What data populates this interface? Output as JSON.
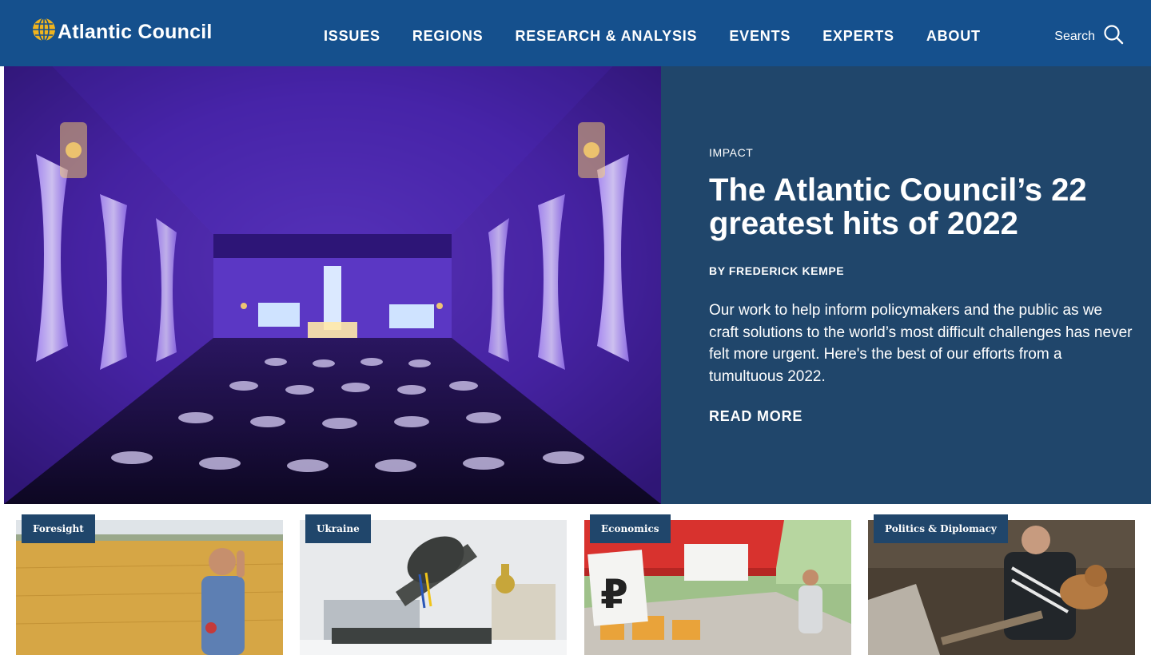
{
  "header": {
    "logo_text": "Atlantic Council",
    "nav": [
      "ISSUES",
      "REGIONS",
      "RESEARCH & ANALYSIS",
      "EVENTS",
      "EXPERTS",
      "ABOUT"
    ],
    "search_label": "Search"
  },
  "hero": {
    "kicker": "IMPACT",
    "headline": "The Atlantic Council’s 22 greatest hits of 2022",
    "byline": "BY FREDERICK KEMPE",
    "dek": "Our work to help inform policymakers and the public as we craft solutions to the world’s most difficult challenges has never felt more urgent. Here's the best of our efforts from a tumultuous 2022.",
    "read_more": "READ MORE"
  },
  "cards": [
    {
      "tag": "Foresight"
    },
    {
      "tag": "Ukraine"
    },
    {
      "tag": "Economics"
    },
    {
      "tag": "Politics & Diplomacy"
    }
  ],
  "colors": {
    "header_bg": "#15508d",
    "panel_bg": "#20466b",
    "logo_accent": "#f0b41e"
  }
}
